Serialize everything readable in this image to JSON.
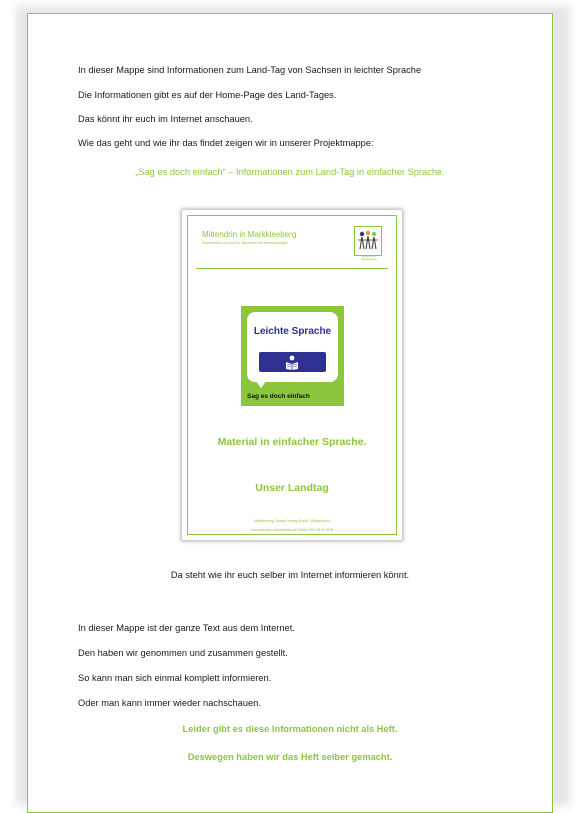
{
  "intro": [
    "In dieser Mappe sind Informationen zum Land-Tag von Sachsen in leichter Sprache",
    "Die Informationen gibt es auf der Home-Page des Land-Tages.",
    "Das könnt ihr euch im Internet anschauen.",
    "Wie das geht und wie ihr das findet zeigen wir in unserer Projektmappe:"
  ],
  "project_title": "„Sag es doch einfach“ – Informationen zum Land-Tag in einfacher Sprache.",
  "cover": {
    "org_title": "Mittendrin in Markkleeberg",
    "org_subtitle": "Projektarbeit von und für Menschen mit Behinderungen",
    "logo_caption": "Mittendrin in Markkleeberg",
    "leichte_sprache": "Leichte Sprache",
    "sag_es": "Sag es doch einfach",
    "material": "Material in einfacher Sprache.",
    "landtag": "Unser Landtag",
    "footer_line1": "Markkleeberg, Gustav-Freytag-Straße 2 (Bürgerhaus)",
    "footer_line2": "www.mittendrin-markkleeberg.de   Telefon 0341 35 54 09 80",
    "accent_color": "#8cc63f",
    "ls_color": "#2e3192"
  },
  "caption": "Da steht wie ihr euch selber im Internet informieren könnt.",
  "body": [
    "In dieser Mappe ist der ganze Text aus dem Internet.",
    "Den haben wir genommen und zusammen gestellt.",
    "So kann man sich einmal komplett informieren.",
    "Oder man kann immer wieder nachschauen."
  ],
  "closing": [
    "Leider gibt es diese Informationen nicht als Heft.",
    "Deswegen haben wir das Heft selber gemacht."
  ]
}
